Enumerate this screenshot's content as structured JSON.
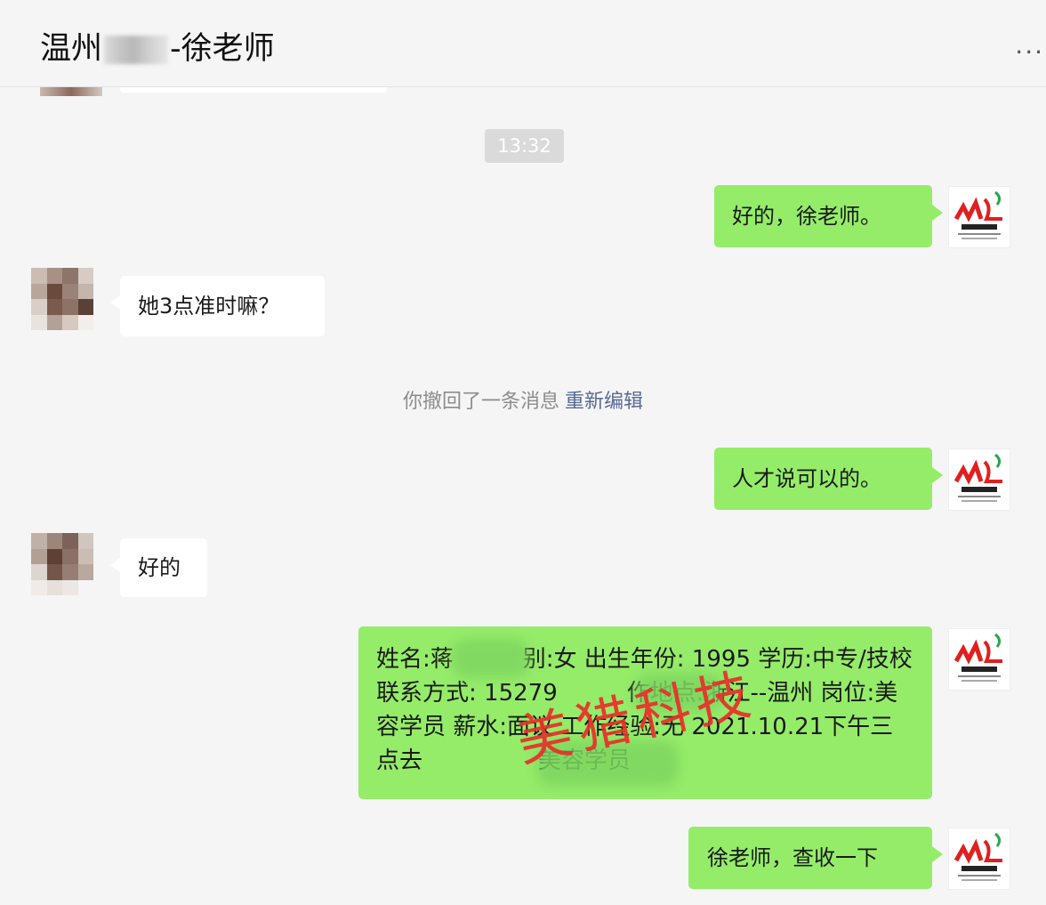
{
  "header": {
    "title_prefix": "温州",
    "title_suffix": "-徐老师",
    "more_glyph": "..."
  },
  "timestamp": "13:32",
  "messages": [
    {
      "side": "out",
      "text": "好的，徐老师。"
    },
    {
      "side": "in",
      "text": "她3点准时嘛？"
    },
    {
      "side": "out",
      "text": "人才说可以的。"
    },
    {
      "side": "in",
      "text": "好的"
    },
    {
      "side": "out",
      "text": "徐老师，查收一下"
    }
  ],
  "recall": {
    "text": "你撤回了一条消息",
    "edit_label": "重新编辑"
  },
  "card": {
    "text": "姓名:蒋　　　别:女 出生年份: 1995 学历:中专/技校 联系方式: 15279　　　作地点:浙江--温州 岗位:美容学员 薪水:面议 工作经验:无 2021.10.21下午三点去　　　　　美容学员"
  },
  "watermark": "美猎科技",
  "colors": {
    "background": "#f5f5f5",
    "outgoing_bubble": "#95ec69",
    "incoming_bubble": "#ffffff",
    "link": "#576b95",
    "watermark": "#e9302a"
  },
  "icons": {
    "self_avatar": "ml-logo",
    "contact_avatar": "pixelated-photo"
  }
}
